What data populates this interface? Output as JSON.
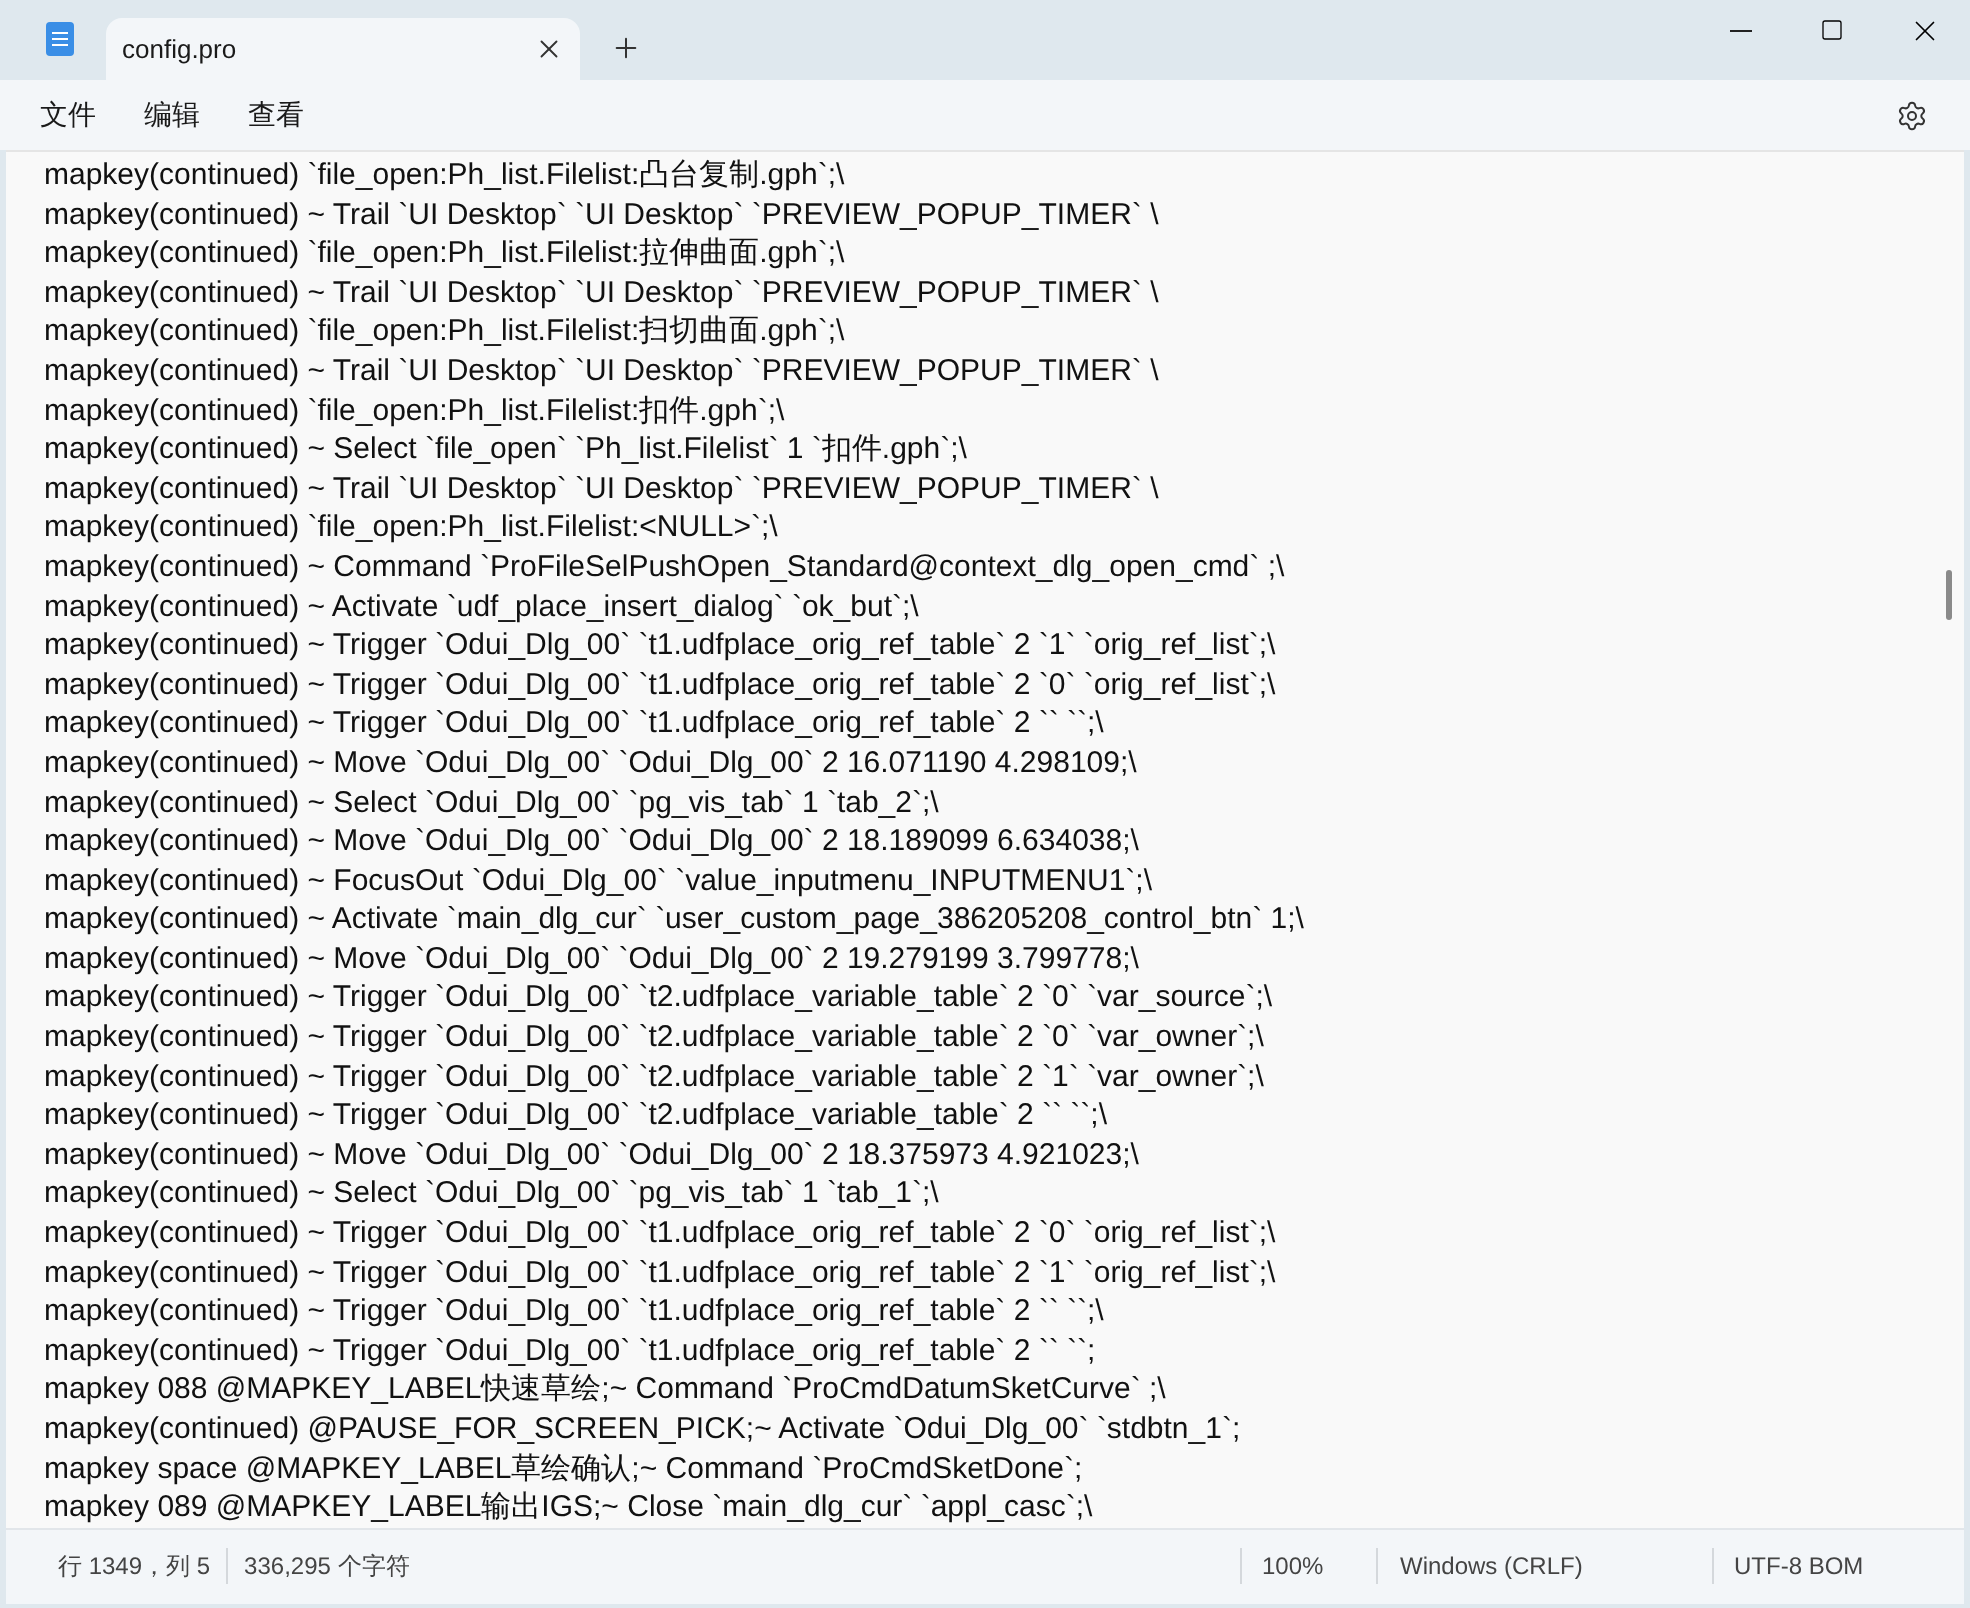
{
  "window": {
    "tabs": [
      {
        "title": "config.pro",
        "selected": true
      }
    ]
  },
  "menu": [
    "文件",
    "编辑",
    "查看"
  ],
  "lines": [
    "mapkey(continued) `file_open:Ph_list.Filelist:凸台复制.gph`;\\",
    "mapkey(continued) ~ Trail `UI Desktop` `UI Desktop` `PREVIEW_POPUP_TIMER` \\",
    "mapkey(continued) `file_open:Ph_list.Filelist:拉伸曲面.gph`;\\",
    "mapkey(continued) ~ Trail `UI Desktop` `UI Desktop` `PREVIEW_POPUP_TIMER` \\",
    "mapkey(continued) `file_open:Ph_list.Filelist:扫切曲面.gph`;\\",
    "mapkey(continued) ~ Trail `UI Desktop` `UI Desktop` `PREVIEW_POPUP_TIMER` \\",
    "mapkey(continued) `file_open:Ph_list.Filelist:扣件.gph`;\\",
    "mapkey(continued) ~ Select `file_open` `Ph_list.Filelist` 1 `扣件.gph`;\\",
    "mapkey(continued) ~ Trail `UI Desktop` `UI Desktop` `PREVIEW_POPUP_TIMER` \\",
    "mapkey(continued) `file_open:Ph_list.Filelist:<NULL>`;\\",
    "mapkey(continued) ~ Command `ProFileSelPushOpen_Standard@context_dlg_open_cmd` ;\\",
    "mapkey(continued) ~ Activate `udf_place_insert_dialog` `ok_but`;\\",
    "mapkey(continued) ~ Trigger `Odui_Dlg_00` `t1.udfplace_orig_ref_table` 2 `1` `orig_ref_list`;\\",
    "mapkey(continued) ~ Trigger `Odui_Dlg_00` `t1.udfplace_orig_ref_table` 2 `0` `orig_ref_list`;\\",
    "mapkey(continued) ~ Trigger `Odui_Dlg_00` `t1.udfplace_orig_ref_table` 2 `` ``;\\",
    "mapkey(continued) ~ Move `Odui_Dlg_00` `Odui_Dlg_00` 2 16.071190 4.298109;\\",
    "mapkey(continued) ~ Select `Odui_Dlg_00` `pg_vis_tab` 1 `tab_2`;\\",
    "mapkey(continued) ~ Move `Odui_Dlg_00` `Odui_Dlg_00` 2 18.189099 6.634038;\\",
    "mapkey(continued) ~ FocusOut `Odui_Dlg_00` `value_inputmenu_INPUTMENU1`;\\",
    "mapkey(continued) ~ Activate `main_dlg_cur` `user_custom_page_386205208_control_btn` 1;\\",
    "mapkey(continued) ~ Move `Odui_Dlg_00` `Odui_Dlg_00` 2 19.279199 3.799778;\\",
    "mapkey(continued) ~ Trigger `Odui_Dlg_00` `t2.udfplace_variable_table` 2 `0` `var_source`;\\",
    "mapkey(continued) ~ Trigger `Odui_Dlg_00` `t2.udfplace_variable_table` 2 `0` `var_owner`;\\",
    "mapkey(continued) ~ Trigger `Odui_Dlg_00` `t2.udfplace_variable_table` 2 `1` `var_owner`;\\",
    "mapkey(continued) ~ Trigger `Odui_Dlg_00` `t2.udfplace_variable_table` 2 `` ``;\\",
    "mapkey(continued) ~ Move `Odui_Dlg_00` `Odui_Dlg_00` 2 18.375973 4.921023;\\",
    "mapkey(continued) ~ Select `Odui_Dlg_00` `pg_vis_tab` 1 `tab_1`;\\",
    "mapkey(continued) ~ Trigger `Odui_Dlg_00` `t1.udfplace_orig_ref_table` 2 `0` `orig_ref_list`;\\",
    "mapkey(continued) ~ Trigger `Odui_Dlg_00` `t1.udfplace_orig_ref_table` 2 `1` `orig_ref_list`;\\",
    "mapkey(continued) ~ Trigger `Odui_Dlg_00` `t1.udfplace_orig_ref_table` 2 `` ``;\\",
    "mapkey(continued) ~ Trigger `Odui_Dlg_00` `t1.udfplace_orig_ref_table` 2 `` ``;",
    "mapkey 088 @MAPKEY_LABEL快速草绘;~ Command `ProCmdDatumSketCurve` ;\\",
    "mapkey(continued) @PAUSE_FOR_SCREEN_PICK;~ Activate `Odui_Dlg_00` `stdbtn_1`;",
    "mapkey space @MAPKEY_LABEL草绘确认;~ Command `ProCmdSketDone`;",
    "mapkey 089 @MAPKEY_LABEL输出IGS;~ Close `main_dlg_cur` `appl_casc`;\\"
  ],
  "status_bar": {
    "position": "行 1349，列 5",
    "characters": "336,295 个字符",
    "zoom": "100%",
    "line_ending": "Windows (CRLF)",
    "encoding": "UTF-8 BOM"
  }
}
